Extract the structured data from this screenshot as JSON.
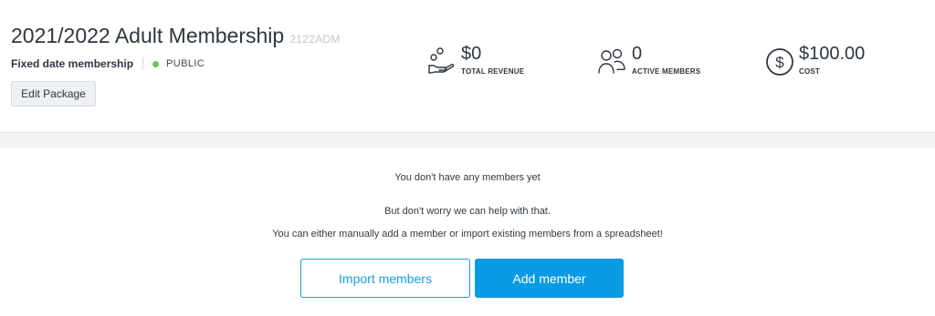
{
  "package": {
    "title": "2021/2022 Adult Membership",
    "code": "2122ADM",
    "type": "Fixed date membership",
    "visibility": "PUBLIC",
    "visibility_color": "#6ac259",
    "edit_label": "Edit Package"
  },
  "stats": [
    {
      "value": "$0",
      "label": "TOTAL REVENUE",
      "icon": "revenue-hand-coins-icon"
    },
    {
      "value": "0",
      "label": "ACTIVE MEMBERS",
      "icon": "members-people-icon"
    },
    {
      "value": "$100.00",
      "label": "COST",
      "icon": "dollar-circle-icon"
    }
  ],
  "empty_state": {
    "line1": "You don't have any members yet",
    "line2": "But don't worry we can help with that.",
    "line3": "You can either manually add a member or import existing members from a spreadsheet!"
  },
  "actions": {
    "import_label": "Import members",
    "add_label": "Add member",
    "primary_color": "#0a9be4"
  }
}
